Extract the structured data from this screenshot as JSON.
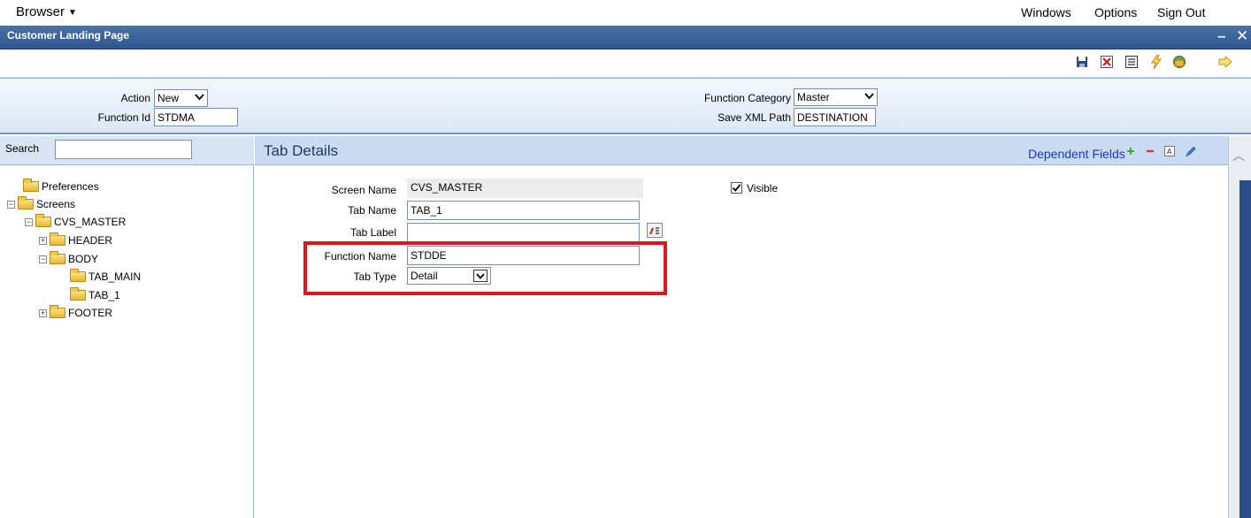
{
  "menubar": {
    "browser_label": "Browser",
    "windows_label": "Windows",
    "options_label": "Options",
    "signout_label": "Sign Out"
  },
  "titlebar": {
    "title": "Customer Landing Page"
  },
  "toolbar": {
    "icons": [
      "save-icon",
      "delete-icon",
      "list-icon",
      "lightning-icon",
      "package-icon",
      "exit-arrow-icon"
    ]
  },
  "header_form": {
    "action_label": "Action",
    "action_value": "New",
    "function_id_label": "Function Id",
    "function_id_value": "STDMA",
    "function_category_label": "Function Category",
    "function_category_value": "Master",
    "save_xml_path_label": "Save XML Path",
    "save_xml_path_value": "DESTINATION"
  },
  "search": {
    "label": "Search",
    "value": ""
  },
  "tree": {
    "preferences": "Preferences",
    "screens": "Screens",
    "cvs_master": "CVS_MASTER",
    "header": "HEADER",
    "body": "BODY",
    "tab_main": "TAB_MAIN",
    "tab_1": "TAB_1",
    "footer": "FOOTER"
  },
  "tab_details": {
    "title": "Tab Details",
    "dependent_fields": "Dependent Fields",
    "screen_name_label": "Screen Name",
    "screen_name_value": "CVS_MASTER",
    "tab_name_label": "Tab Name",
    "tab_name_value": "TAB_1",
    "tab_label_label": "Tab Label",
    "tab_label_value": "",
    "function_name_label": "Function Name",
    "function_name_value": "STDDE",
    "tab_type_label": "Tab Type",
    "tab_type_value": "Detail",
    "visible_label": "Visible",
    "visible_checked": true
  },
  "colors": {
    "titlebar": "#2f578d",
    "highlight_box": "#e0161e",
    "link": "#1a37c4"
  }
}
